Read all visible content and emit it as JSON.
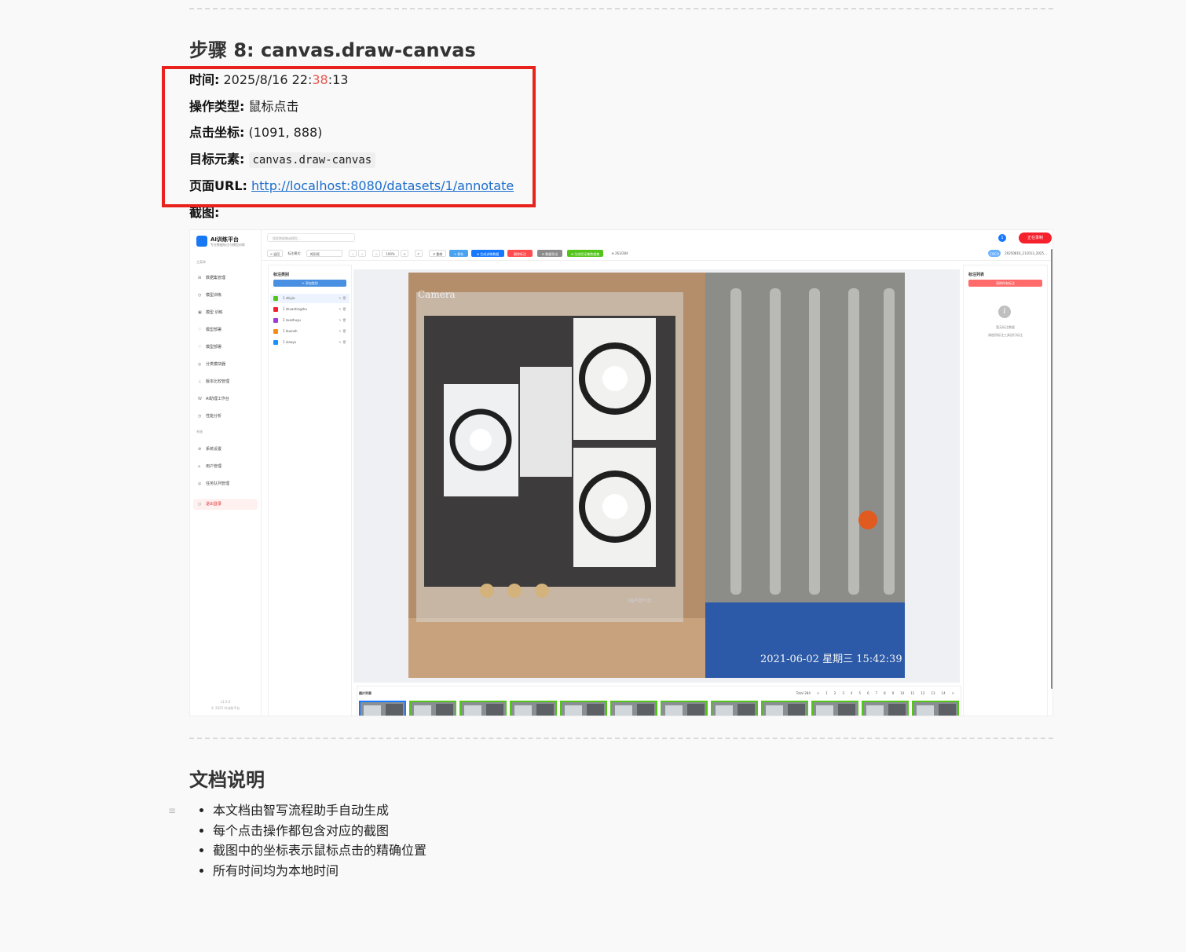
{
  "step": {
    "heading": "步骤 8: canvas.draw-canvas",
    "time_label": "时间:",
    "time_value_before": "2025/8/16 22:",
    "time_value_highlight": "38",
    "time_value_after": ":13",
    "op_label": "操作类型:",
    "op_value": "鼠标点击",
    "coord_label": "点击坐标:",
    "coord_value": "(1091, 888)",
    "target_label": "目标元素:",
    "target_value": "canvas.draw-canvas",
    "url_label": "页面URL:",
    "url_value": "http://localhost:8080/datasets/1/annotate",
    "shot_label": "截图:"
  },
  "screenshot": {
    "brand": "AI训练平台",
    "brand_sub": "专业数据标注与模型训练",
    "search_placeholder": "搜索数据集或模型...",
    "badge": "1",
    "record_button": "正在录制",
    "group_main": "主菜单",
    "group_sys": "系统",
    "nav": [
      {
        "icon": "⊞",
        "label": "数据集管理"
      },
      {
        "icon": "◷",
        "label": "模型训练"
      },
      {
        "icon": "▣",
        "label": "模型 训练"
      },
      {
        "icon": "♡",
        "label": "模型部署"
      },
      {
        "icon": "♡",
        "label": "模型部署"
      },
      {
        "icon": "◎",
        "label": "分类模块器"
      },
      {
        "icon": "⊥",
        "label": "版本比较管理"
      },
      {
        "icon": "W",
        "label": "AI助理工作台"
      },
      {
        "icon": "◷",
        "label": "性能分析"
      }
    ],
    "nav_sys": [
      {
        "icon": "⚙",
        "label": "系统设置"
      },
      {
        "icon": "⌂",
        "label": "用户管理"
      },
      {
        "icon": "◎",
        "label": "任务队列管理"
      }
    ],
    "exit_label": "退出登录",
    "version": "v1.0.0",
    "copyright": "© 2025 AI训练平台",
    "toolbar": {
      "back": "< 返回",
      "mode": "标注模式:",
      "mode_value": "矩形框",
      "zoom": "100%",
      "undo": "撤销",
      "redo": "↺ 重做",
      "save": "+ 保存",
      "gen": "⊕ 生成训练数据",
      "delete": "删除标注",
      "export": "⊟ 数据导出",
      "gen_val": "⊕ 生成验证集数据集",
      "count": "⊕ 263/284",
      "tag": "COCO",
      "file": "20250816_211013_2025..."
    },
    "labels_title": "标注类别",
    "add_label": "+ 添加类别",
    "labels": [
      {
        "name": "1  shiyie",
        "color": "#52c41a"
      },
      {
        "name": "1  zhuantingzhu",
        "color": "#f5222d"
      },
      {
        "name": "2  zuozhuyu",
        "color": "#a23ad6"
      },
      {
        "name": "1  duonzh",
        "color": "#fa8c16"
      },
      {
        "name": "1  xiaoyu",
        "color": "#1890ff"
      }
    ],
    "right_title": "标注列表",
    "clear_label": "清除所有标注",
    "empty_1": "暂无标注数据",
    "empty_2": "请使用标注工具进行标注",
    "strip_title": "图片列表",
    "pager_total": "Total 284",
    "pager_pages": [
      "<",
      "1",
      "2",
      "3",
      "4",
      "5",
      "6",
      "7",
      "8",
      "9",
      "10",
      "11",
      "12",
      "13",
      "14",
      ">"
    ],
    "photo_brand": "Camera",
    "photo_timestamp": "2021-06-02  星期三  15:42:39",
    "photo_product": "国产燃气灶"
  },
  "docs": {
    "heading": "文档说明",
    "items": [
      "本文档由智写流程助手自动生成",
      "每个点击操作都包含对应的截图",
      "截图中的坐标表示鼠标点击的精确位置",
      "所有时间均为本地时间"
    ]
  },
  "colors": {
    "highlight_box": "#e8231d",
    "link": "#1a6dcc",
    "time_highlight": "#e5574f"
  }
}
